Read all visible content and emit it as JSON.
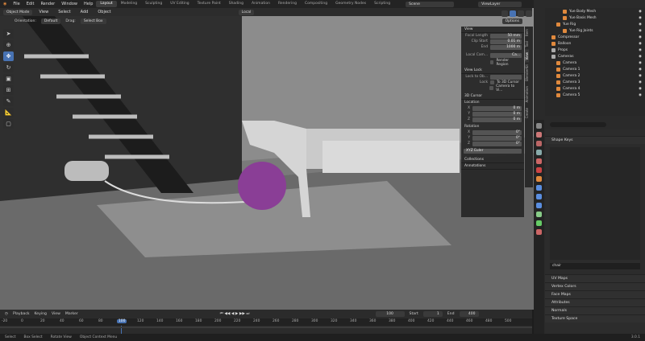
{
  "topbar": {
    "menus": [
      "File",
      "Edit",
      "Render",
      "Window",
      "Help"
    ],
    "workspaces": [
      "Layout",
      "Modeling",
      "Sculpting",
      "UV Editing",
      "Texture Paint",
      "Shading",
      "Animation",
      "Rendering",
      "Compositing",
      "Geometry Nodes",
      "Scripting"
    ],
    "scene": "Scene",
    "viewlayer": "ViewLayer"
  },
  "viewport_header": {
    "mode": "Object Mode",
    "menus": [
      "View",
      "Select",
      "Add",
      "Object"
    ],
    "orientation": "Local",
    "options": "Options"
  },
  "subheader": {
    "items": [
      "Orientation:",
      "Default",
      "Drag:",
      "Select Box"
    ]
  },
  "npanel": {
    "tabs": [
      "Item",
      "Tool",
      "View",
      "BlenderKit",
      "Animation",
      "Create"
    ],
    "view_header": "View",
    "focal_length_label": "Focal Length",
    "focal_length": "50 mm",
    "clip_start_label": "Clip Start",
    "clip_start": "0.01 m",
    "end_label": "End",
    "end": "1000 m",
    "local_camera_label": "Local Cam...",
    "local_camera": "Ca...",
    "render_region": "Render Region",
    "view_lock_header": "View Lock",
    "lock_to_object_label": "Lock to Ob...",
    "lock_label": "Lock",
    "to_3d_cursor": "To 3D Cursor",
    "camera_to_view": "Camera to Vi...",
    "cursor_header": "3D Cursor",
    "location_label": "Location",
    "x_label": "X",
    "y_label": "Y",
    "z_label": "Z",
    "loc_x": "0 m",
    "loc_y": "0 m",
    "loc_z": "0 m",
    "rotation_label": "Rotation",
    "rot_x": "0°",
    "rot_y": "0°",
    "rot_z": "0°",
    "rotation_mode": "XYZ Euler",
    "collections": "Collections",
    "annotations": "Annotations"
  },
  "outliner": {
    "rows": [
      {
        "label": "Yue Body Mesh"
      },
      {
        "label": "Yue Basis Mesh"
      },
      {
        "label": "Yue Rig"
      },
      {
        "label": "Yue Rig Joints"
      },
      {
        "label": "Compressor"
      },
      {
        "label": "Balloon"
      },
      {
        "label": "Props"
      },
      {
        "label": "Cameras"
      },
      {
        "label": "Camera"
      },
      {
        "label": "Camera 1"
      },
      {
        "label": "Camera 2"
      },
      {
        "label": "Camera 3"
      },
      {
        "label": "Camera 4"
      },
      {
        "label": "Camera 5"
      }
    ]
  },
  "properties": {
    "shape_keys": "Shape Keys",
    "search_value": "chair",
    "sections": [
      "UV Maps",
      "Vertex Colors",
      "Face Maps",
      "Attributes",
      "Normals",
      "Texture Space"
    ]
  },
  "timeline": {
    "menus": [
      "Playback",
      "Keying",
      "View",
      "Marker"
    ],
    "current_frame": "100",
    "start_label": "Start",
    "start": "1",
    "end_label": "End",
    "end": "400",
    "ticks": [
      "-20",
      "0",
      "20",
      "40",
      "60",
      "80",
      "100",
      "120",
      "140",
      "160",
      "180",
      "200",
      "220",
      "240",
      "260",
      "280",
      "300",
      "320",
      "340",
      "360",
      "380",
      "400",
      "420",
      "440",
      "460",
      "480",
      "500"
    ]
  },
  "statusbar": {
    "items": [
      "Select",
      "Box Select",
      "Rotate View",
      "Object Context Menu"
    ],
    "version": "3.0.1"
  },
  "colors": {
    "accent": "#4772b3",
    "ball": "#8a3e96",
    "orange": "#e0893d"
  }
}
